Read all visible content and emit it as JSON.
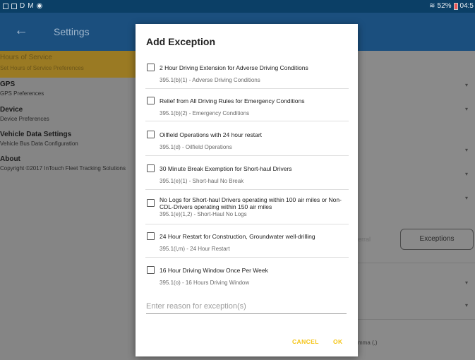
{
  "status_bar": {
    "left_icons": [
      "sim-icon",
      "mail-icon",
      "D",
      "M",
      "wifi-icon"
    ],
    "battery": "52%",
    "time": "04:5"
  },
  "app_bar": {
    "title": "Settings"
  },
  "sidebar": {
    "items": [
      {
        "title": "Hours of Service",
        "subtitle": "Set Hours of Service Preferences"
      },
      {
        "title": "GPS",
        "subtitle": "GPS Preferences"
      },
      {
        "title": "Device",
        "subtitle": "Device Preferences"
      },
      {
        "title": "Vehicle Data Settings",
        "subtitle": "Vehicle Bus Data Configuration"
      },
      {
        "title": "About",
        "subtitle": "Copyright ©2017 InTouch Fleet Tracking Solutions"
      }
    ]
  },
  "background": {
    "deferral_text": "erral",
    "exceptions_button": "Exceptions",
    "comma_hint": "mma (,)"
  },
  "dialog": {
    "title": "Add Exception",
    "options": [
      {
        "label": "2 Hour Driving Extension for Adverse Driving Conditions",
        "sub": "395.1(b)(1) - Adverse Driving Conditions",
        "checked": false
      },
      {
        "label": "Relief from All Driving Rules for Emergency Conditions",
        "sub": "395.1(b)(2) - Emergency Conditions",
        "checked": false
      },
      {
        "label": "Oilfield Operations with 24 hour restart",
        "sub": "395.1(d) - Oilfield Operations",
        "checked": false
      },
      {
        "label": "30 Minute Break Exemption for Short-haul Drivers",
        "sub": "395.1(e)(1) - Short-haul No Break",
        "checked": false
      },
      {
        "label": "No Logs for Short-haul Drivers operating within 100 air miles or Non-CDL-Drivers operating within 150 air miles",
        "sub": "395.1(e)(1,2) - Short-Haul No Logs",
        "checked": false
      },
      {
        "label": "24 Hour Restart for Construction, Groundwater well-drilling",
        "sub": "395.1(l,m) - 24 Hour Restart",
        "checked": false
      },
      {
        "label": "16 Hour Driving Window Once Per Week",
        "sub": "395.1(o) - 16 Hours Driving Window",
        "checked": false
      }
    ],
    "reason_placeholder": "Enter reason for exception(s)",
    "reason_value": "",
    "cancel_label": "CANCEL",
    "ok_label": "OK"
  },
  "colors": {
    "accent": "#f5c518",
    "app_bar": "#1b4f7e",
    "status_bar": "#0b3f66"
  }
}
